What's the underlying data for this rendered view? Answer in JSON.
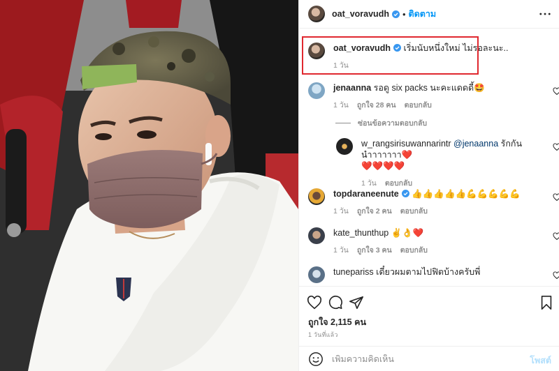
{
  "header": {
    "username": "oat_voravudh",
    "separator": "•",
    "follow_label": "ติดตาม"
  },
  "caption": {
    "username": "oat_voravudh",
    "text": "เริ่มนับหนึ่งใหม่ ไม่รอละนะ..",
    "time": "1 วัน"
  },
  "comments": [
    {
      "username": "jenaanna",
      "text": "รอดู six packs นะคะแดดดี้🤩",
      "time": "1 วัน",
      "likes": "ถูกใจ 28 คน",
      "reply_label": "ตอบกลับ"
    },
    {
      "username": "w_rangsirisuwannarintr",
      "mention": "@jenaanna",
      "text": "รักกันนำาาาาาา❤️",
      "text2": "❤️❤️❤️❤️",
      "time": "1 วัน",
      "reply_label": "ตอบกลับ"
    },
    {
      "username": "topdaraneenute",
      "text": "👍👍👍👍👍💪💪💪💪💪",
      "time": "1 วัน",
      "likes": "ถูกใจ 2 คน",
      "reply_label": "ตอบกลับ"
    },
    {
      "username": "kate_thunthup",
      "text": "✌️👌❤️",
      "time": "1 วัน",
      "likes": "ถูกใจ 3 คน",
      "reply_label": "ตอบกลับ"
    },
    {
      "username": "tunepariss",
      "text": "เดี๋ยวผมตามไปฟิตบ้างครับพี่"
    }
  ],
  "hide_replies_label": "ซ่อนข้อความตอบกลับ",
  "likes_total": "ถูกใจ 2,115 คน",
  "post_time": "1 วันที่แล้ว",
  "composer": {
    "placeholder": "เพิ่มความคิดเห็น",
    "post_label": "โพสต์"
  },
  "icons": {
    "like": "heart-icon",
    "comment": "comment-icon",
    "share": "send-icon",
    "save": "bookmark-icon",
    "more": "more-options-icon",
    "emoji": "emoji-icon",
    "verified": "verified-badge-icon"
  },
  "colors": {
    "follow": "#0095f6",
    "verified": "#3897f0",
    "highlight": "#e0282f",
    "muted": "#8e8e8e"
  }
}
